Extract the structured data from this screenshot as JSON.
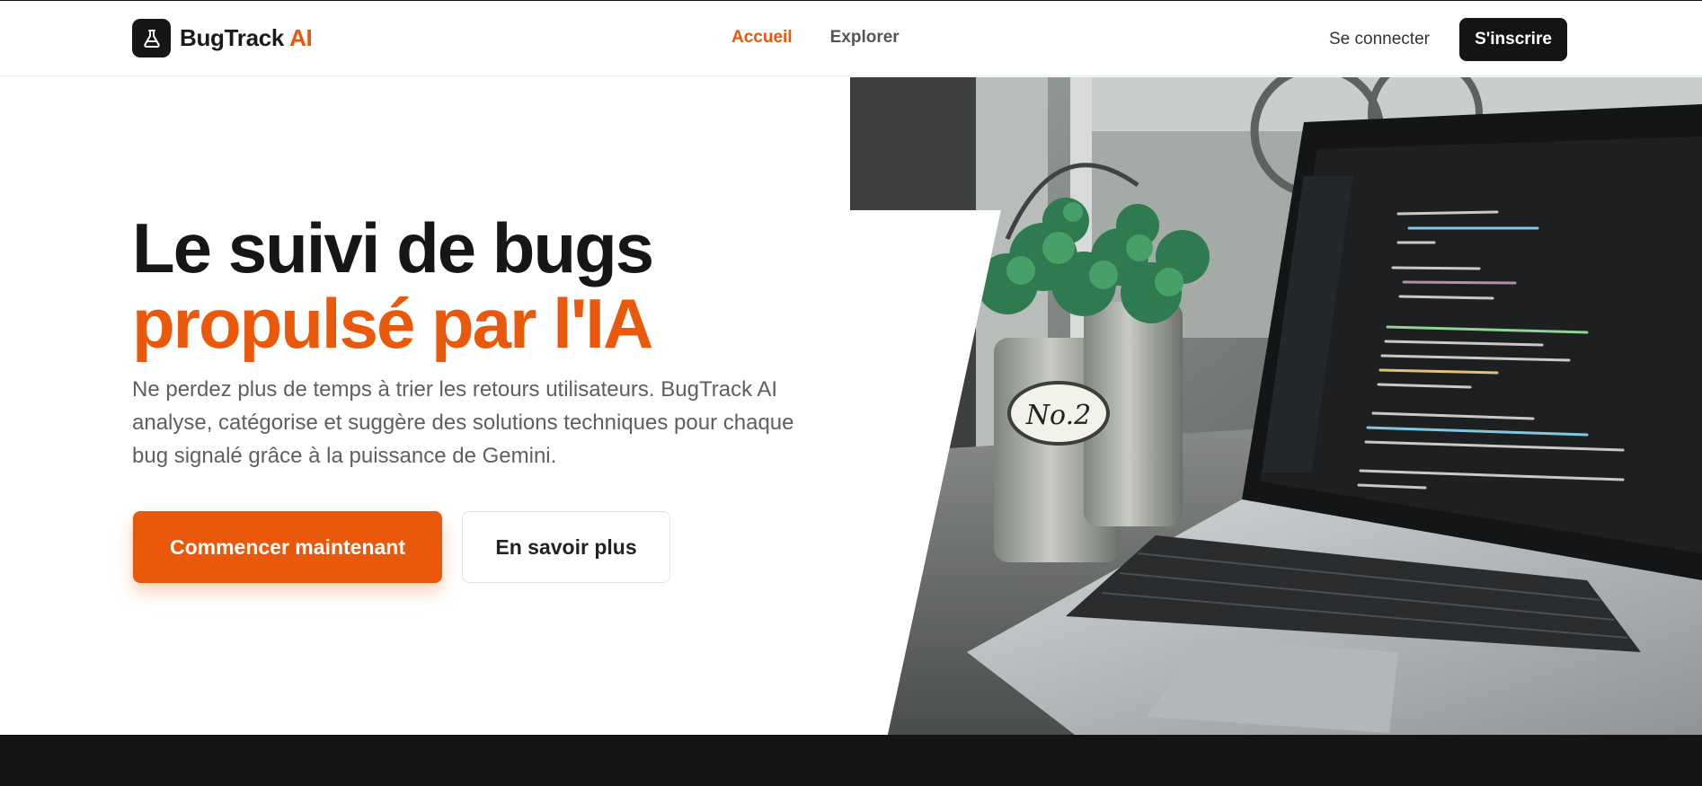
{
  "header": {
    "brand_main": "BugTrack",
    "brand_accent": "AI",
    "logo_icon": "flask-icon",
    "nav": [
      {
        "label": "Accueil",
        "active": true
      },
      {
        "label": "Explorer",
        "active": false
      }
    ],
    "login_label": "Se connecter",
    "signup_label": "S'inscrire"
  },
  "hero": {
    "title_line1": "Le suivi de bugs",
    "title_line2": "propulsé par l'IA",
    "subtitle": "Ne perdez plus de temps à trier les retours utilisateurs. BugTrack AI analyse, catégorise et suggère des solutions techniques pour chaque bug signalé grâce à la puissance de Gemini.",
    "primary_cta": "Commencer maintenant",
    "secondary_cta": "En savoir plus",
    "pot_label": "No.2"
  },
  "colors": {
    "accent": "#ea580c",
    "dark": "#141414"
  }
}
